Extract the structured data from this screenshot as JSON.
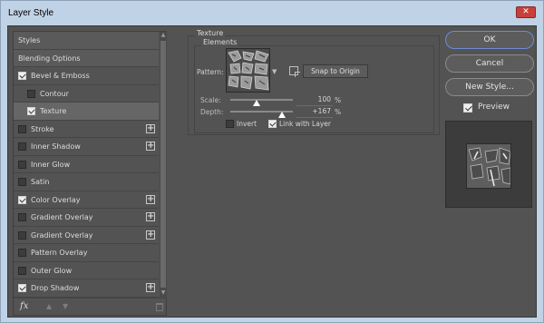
{
  "window": {
    "title": "Layer Style",
    "close_label": "✕"
  },
  "styles_list": [
    {
      "label": "Styles",
      "kind": "header",
      "checkbox": false,
      "checked": false,
      "plus": false,
      "indent": false
    },
    {
      "label": "Blending Options",
      "kind": "header",
      "checkbox": false,
      "checked": false,
      "plus": false,
      "indent": false
    },
    {
      "label": "Bevel & Emboss",
      "kind": "item",
      "checkbox": true,
      "checked": true,
      "plus": false,
      "indent": false
    },
    {
      "label": "Contour",
      "kind": "item",
      "checkbox": true,
      "checked": false,
      "plus": false,
      "indent": true
    },
    {
      "label": "Texture",
      "kind": "selected",
      "checkbox": true,
      "checked": true,
      "plus": false,
      "indent": true
    },
    {
      "label": "Stroke",
      "kind": "item",
      "checkbox": true,
      "checked": false,
      "plus": true,
      "indent": false
    },
    {
      "label": "Inner Shadow",
      "kind": "item",
      "checkbox": true,
      "checked": false,
      "plus": true,
      "indent": false
    },
    {
      "label": "Inner Glow",
      "kind": "item",
      "checkbox": true,
      "checked": false,
      "plus": false,
      "indent": false
    },
    {
      "label": "Satin",
      "kind": "item",
      "checkbox": true,
      "checked": false,
      "plus": false,
      "indent": false
    },
    {
      "label": "Color Overlay",
      "kind": "item",
      "checkbox": true,
      "checked": true,
      "plus": true,
      "indent": false
    },
    {
      "label": "Gradient Overlay",
      "kind": "item",
      "checkbox": true,
      "checked": false,
      "plus": true,
      "indent": false
    },
    {
      "label": "Gradient Overlay",
      "kind": "item",
      "checkbox": true,
      "checked": false,
      "plus": true,
      "indent": false
    },
    {
      "label": "Pattern Overlay",
      "kind": "item",
      "checkbox": true,
      "checked": false,
      "plus": false,
      "indent": false
    },
    {
      "label": "Outer Glow",
      "kind": "item",
      "checkbox": true,
      "checked": false,
      "plus": false,
      "indent": false
    },
    {
      "label": "Drop Shadow",
      "kind": "item",
      "checkbox": true,
      "checked": true,
      "plus": true,
      "indent": false
    }
  ],
  "left_toolbar": {
    "fx_label": "fx",
    "up_icon": "arrow-up-icon",
    "down_icon": "arrow-down-icon",
    "trash_icon": "trash-icon"
  },
  "texture": {
    "group_title": "Texture",
    "subgroup_title": "Elements",
    "pattern_label": "Pattern:",
    "snap_button": "Snap to Origin",
    "scale_label": "Scale:",
    "scale_value": "100",
    "scale_unit": "%",
    "scale_level": 0.42,
    "depth_label": "Depth:",
    "depth_value": "+167",
    "depth_unit": "%",
    "depth_level": 0.83,
    "invert_label": "Invert",
    "invert_checked": false,
    "link_label": "Link with Layer",
    "link_checked": true
  },
  "buttons": {
    "ok": "OK",
    "cancel": "Cancel",
    "new_style": "New Style..."
  },
  "preview": {
    "label": "Preview",
    "checked": true
  },
  "colors": {
    "panel": "#535353",
    "accent": "#6d8bd4",
    "close": "#c7403a"
  }
}
